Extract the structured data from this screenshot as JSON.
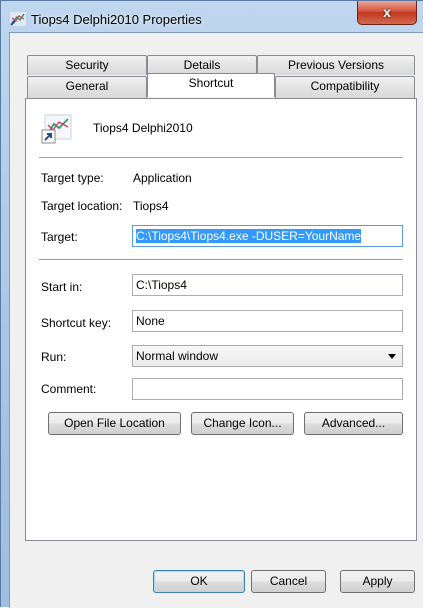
{
  "window": {
    "title": "Tiops4 Delphi2010 Properties",
    "close_glyph": "x"
  },
  "tabs": {
    "row1": [
      {
        "label": "Security"
      },
      {
        "label": "Details"
      },
      {
        "label": "Previous Versions"
      }
    ],
    "row2": [
      {
        "label": "General"
      },
      {
        "label": "Shortcut"
      },
      {
        "label": "Compatibility"
      }
    ],
    "active": "Shortcut"
  },
  "shortcut": {
    "name": "Tiops4 Delphi2010",
    "icon": "shortcut-app-icon",
    "target_type_label": "Target type:",
    "target_type": "Application",
    "target_location_label": "Target location:",
    "target_location": "Tiops4",
    "target_label": "Target:",
    "target": "C:\\Tiops4\\Tiops4.exe -DUSER=YourName",
    "start_in_label": "Start in:",
    "start_in": "C:\\Tiops4",
    "shortcut_key_label": "Shortcut key:",
    "shortcut_key": "None",
    "run_label": "Run:",
    "run": "Normal window",
    "comment_label": "Comment:",
    "comment": ""
  },
  "buttons": {
    "open_file_location": "Open File Location",
    "change_icon": "Change Icon...",
    "advanced": "Advanced...",
    "ok": "OK",
    "cancel": "Cancel",
    "apply": "Apply"
  },
  "colors": {
    "selection": "#3399ff",
    "close": "#c0381f"
  }
}
